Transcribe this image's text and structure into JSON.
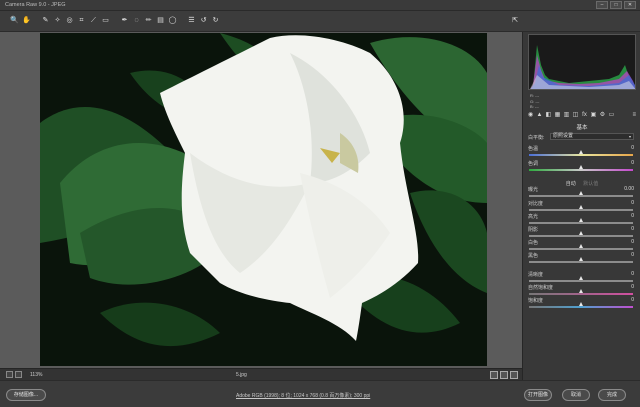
{
  "window": {
    "title": "Camera Raw 9.0 - JPEG",
    "minimize": "–",
    "maximize": "□",
    "close": "✕"
  },
  "toolbar": {
    "tools": [
      {
        "name": "zoom-tool-icon",
        "glyph": "🔍"
      },
      {
        "name": "hand-tool-icon",
        "glyph": "✋"
      },
      {
        "name": "sep1",
        "glyph": ""
      },
      {
        "name": "white-balance-tool-icon",
        "glyph": "✎"
      },
      {
        "name": "color-sampler-tool-icon",
        "glyph": "✧"
      },
      {
        "name": "targeted-adjustment-tool-icon",
        "glyph": "◎"
      },
      {
        "name": "crop-tool-icon",
        "glyph": "⌗"
      },
      {
        "name": "straighten-tool-icon",
        "glyph": "⟋"
      },
      {
        "name": "transform-tool-icon",
        "glyph": "▭"
      },
      {
        "name": "sep2",
        "glyph": ""
      },
      {
        "name": "spot-removal-tool-icon",
        "glyph": "✒"
      },
      {
        "name": "red-eye-tool-icon",
        "glyph": "◌"
      },
      {
        "name": "adjustment-brush-tool-icon",
        "glyph": "✏"
      },
      {
        "name": "graduated-filter-tool-icon",
        "glyph": "▤"
      },
      {
        "name": "radial-filter-tool-icon",
        "glyph": "◯"
      },
      {
        "name": "sep3",
        "glyph": ""
      },
      {
        "name": "preferences-icon",
        "glyph": "☰"
      },
      {
        "name": "rotate-ccw-icon",
        "glyph": "↺"
      },
      {
        "name": "rotate-cw-icon",
        "glyph": "↻"
      }
    ],
    "fullscreen_glyph": "⇱"
  },
  "histogram": {
    "rgb_r": "R: ---",
    "rgb_g": "G: ---",
    "rgb_b": "B: ---"
  },
  "panel": {
    "icons": [
      "◉",
      "▲",
      "◧",
      "▦",
      "▥",
      "◫",
      "fx",
      "▣",
      "⚙",
      "▭"
    ],
    "menu_icon": "≡",
    "title": "基本",
    "white_balance_label": "白平衡:",
    "white_balance_value": "原照设置",
    "auto_label": "自动",
    "default_label": "默认值",
    "sliders": [
      {
        "label": "色温",
        "value": "0",
        "pos": 0.5
      },
      {
        "label": "色调",
        "value": "0",
        "pos": 0.5
      },
      {
        "label": "曝光",
        "value": "0.00",
        "pos": 0.5
      },
      {
        "label": "对比度",
        "value": "0",
        "pos": 0.5
      },
      {
        "label": "高光",
        "value": "0",
        "pos": 0.5
      },
      {
        "label": "阴影",
        "value": "0",
        "pos": 0.5
      },
      {
        "label": "白色",
        "value": "0",
        "pos": 0.5
      },
      {
        "label": "黑色",
        "value": "0",
        "pos": 0.5
      },
      {
        "label": "清晰度",
        "value": "0",
        "pos": 0.5
      },
      {
        "label": "自然饱和度",
        "value": "0",
        "pos": 0.5
      },
      {
        "label": "饱和度",
        "value": "0",
        "pos": 0.5
      }
    ]
  },
  "status": {
    "zoom": "113%",
    "filename": "5.jpg"
  },
  "bottom": {
    "save_label": "存储图像...",
    "info_link": "Adobe RGB (1998); 8 位; 1024 x 768 (0.8 百万像素); 300 ppi",
    "open_label": "打开图像",
    "cancel_label": "取消",
    "done_label": "完成"
  },
  "colors": {
    "leaf": "#2f6b35",
    "leaf_dark": "#173d1c",
    "background": "#0b160c",
    "flower": "#f3f4f0"
  }
}
